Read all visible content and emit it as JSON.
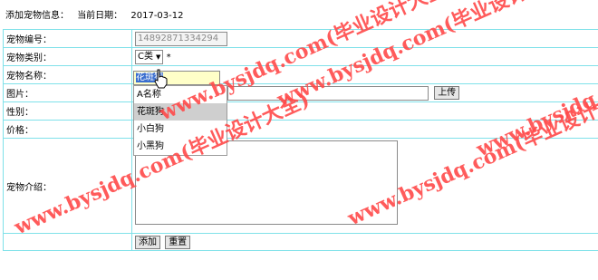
{
  "header": {
    "title": "添加宠物信息：",
    "date_label": "当前日期：",
    "date_value": "2017-03-12"
  },
  "form": {
    "pet_id": {
      "label": "宠物编号：",
      "value": "14892871334294"
    },
    "pet_type": {
      "label": "宠物类别：",
      "selected": "C类",
      "required_mark": "*"
    },
    "pet_name": {
      "label": "宠物名称：",
      "value": "花斑狗",
      "autocomplete_options": [
        "A名称",
        "花斑狗",
        "小白狗",
        "小黑狗"
      ],
      "highlighted_index": 1
    },
    "image": {
      "label": "图片：",
      "upload_label": "上传"
    },
    "gender": {
      "label": "性别："
    },
    "price": {
      "label": "价格："
    },
    "description": {
      "label": "宠物介绍："
    },
    "buttons": {
      "add_label": "添加",
      "reset_label": "重置"
    }
  },
  "watermark": {
    "text": "www.bysjdq.com(毕业设计大全)",
    "color": "#ff4a4a"
  },
  "icons": {
    "cursor": "hand-pointer-icon",
    "dropdown": "triangle-down-icon"
  }
}
